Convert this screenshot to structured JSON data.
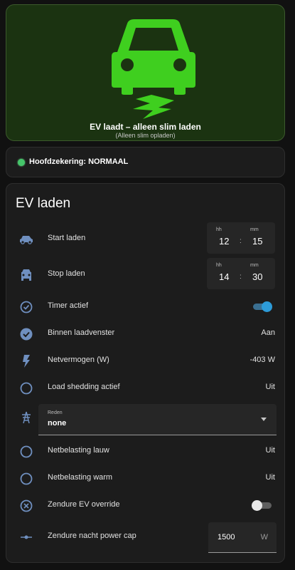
{
  "hero": {
    "title": "EV laadt – alleen slim laden",
    "subtitle": "(Alleen slim opladen)",
    "car_icon": "car-icon",
    "bolt_icon": "lightning-bolt-icon",
    "accent": "#3fcf1f"
  },
  "status": {
    "text": "Hoofdzekering: NORMAAL",
    "dot_color": "#45c56a"
  },
  "card": {
    "title": "EV laden",
    "start": {
      "label": "Start laden",
      "hh_label": "hh",
      "mm_label": "mm",
      "hh": "12",
      "mm": "15",
      "sep": ":"
    },
    "stop": {
      "label": "Stop laden",
      "hh_label": "hh",
      "mm_label": "mm",
      "hh": "14",
      "mm": "30",
      "sep": ":"
    },
    "timer_actief": {
      "label": "Timer actief",
      "state": "on"
    },
    "binnen_laadvenster": {
      "label": "Binnen laadvenster",
      "value": "Aan"
    },
    "netvermogen": {
      "label": "Netvermogen (W)",
      "value": "-403 W"
    },
    "load_shedding": {
      "label": "Load shedding actief",
      "value": "Uit"
    },
    "reden": {
      "label": "Reden",
      "value": "none"
    },
    "netbelasting_lauw": {
      "label": "Netbelasting lauw",
      "value": "Uit"
    },
    "netbelasting_warm": {
      "label": "Netbelasting warm",
      "value": "Uit"
    },
    "zendure_override": {
      "label": "Zendure EV override",
      "state": "off"
    },
    "zendure_cap": {
      "label": "Zendure nacht power cap",
      "value": "1500",
      "unit": "W"
    }
  },
  "colors": {
    "icon": "#6f8fbf",
    "toggle_on": "#2d9bd8"
  }
}
